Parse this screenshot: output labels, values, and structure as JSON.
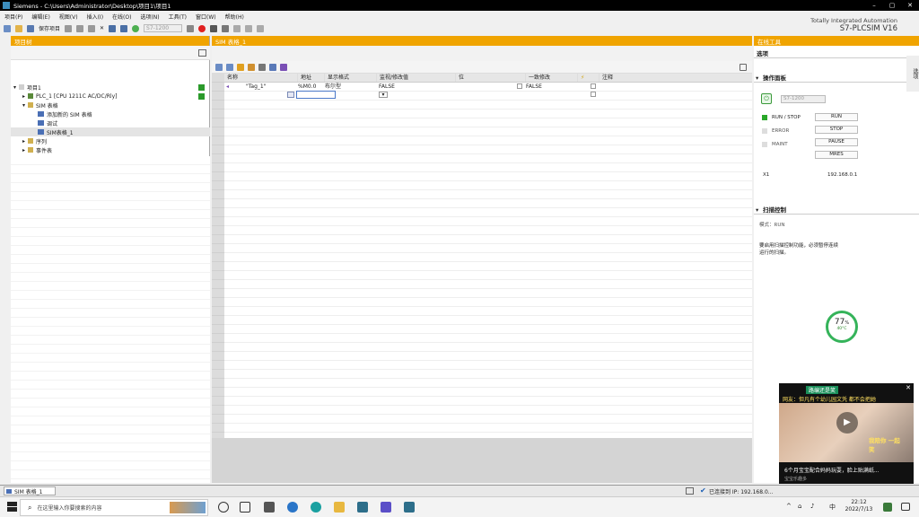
{
  "window": {
    "title": "Siemens  -  C:\\Users\\Administrator\\Desktop\\项目1\\项目1"
  },
  "menu": [
    "项目(P)",
    "编辑(E)",
    "视图(V)",
    "插入(I)",
    "在线(O)",
    "选项(N)",
    "工具(T)",
    "窗口(W)",
    "帮助(H)"
  ],
  "toolbar": {
    "save_label": "保存项目",
    "device": "S7-1200"
  },
  "branding": {
    "line1": "Totally Integrated Automation",
    "line2": "S7-PLCSIM V16"
  },
  "project_tree": {
    "title": "项目树",
    "items": [
      {
        "label": "项目1",
        "indent": 1
      },
      {
        "label": "PLC_1 [CPU 1211C AC/DC/Rly]",
        "indent": 2
      },
      {
        "label": "SIM 表格",
        "indent": 2
      },
      {
        "label": "添加新的 SIM 表格",
        "indent": 3
      },
      {
        "label": "调试",
        "indent": 3
      },
      {
        "label": "SIM表格_1",
        "indent": 3
      },
      {
        "label": "序列",
        "indent": 2
      },
      {
        "label": "事件表",
        "indent": 2
      }
    ]
  },
  "sim_table": {
    "title": "SIM 表格_1",
    "columns": [
      "名称",
      "地址",
      "显示格式",
      "监视/修改值",
      "位",
      "一致修改",
      "",
      "注释"
    ],
    "rows": [
      {
        "name": "\"Tag_1\"",
        "address": "%M0.0",
        "format": "布尔型",
        "monitor": "FALSE",
        "consistent": "FALSE"
      }
    ]
  },
  "online_tools": {
    "title": "在线工具",
    "options": "选项",
    "op_panel": {
      "title": "操作面板",
      "device": "S7-1200",
      "leds": [
        "RUN / STOP",
        "ERROR",
        "MAINT"
      ],
      "buttons": [
        "RUN",
        "STOP",
        "PAUSE",
        "MRES"
      ],
      "x1_label": "X1",
      "ip": "192.168.0.1"
    },
    "scan": {
      "title": "扫描控制",
      "mode": "模式：RUN",
      "desc1": "要启用扫描控制功能，必须暂停连续",
      "desc2": "运行的扫描。"
    }
  },
  "gauge": {
    "value": "77",
    "unit": "%",
    "temp": "40°C"
  },
  "ad": {
    "top": "网友：但凡有个幼儿园文凭 都不会把她",
    "tag1": "路编还是笑",
    "tag2": "我陪你 一起笑",
    "caption": "6个月宝宝配合妈妈玩耍，脸上贴满纸...",
    "sub": "宝宝乐趣多"
  },
  "statusbar": {
    "tab": "SIM 表格_1",
    "conn": "已连接到 IP: 192.168.0..."
  },
  "taskbar": {
    "search": "在这里输入你要搜索的内容",
    "time": "22:12",
    "date": "2022/7/13",
    "lang": "中"
  },
  "side_tab": "选项"
}
